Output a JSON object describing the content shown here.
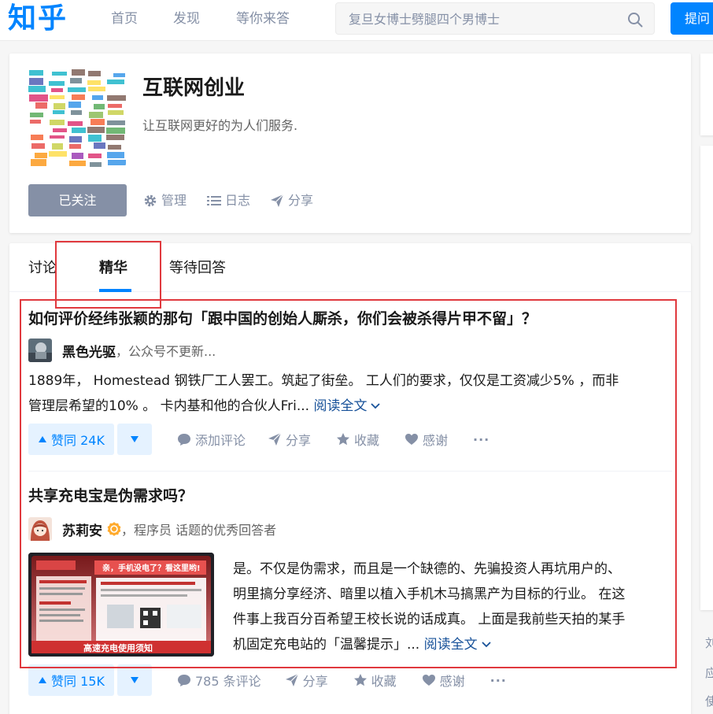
{
  "header": {
    "logo": "知乎",
    "nav": [
      "首页",
      "发现",
      "等你来答"
    ],
    "search_placeholder": "复旦女博士劈腿四个男博士",
    "ask_label": "提问"
  },
  "topic": {
    "title": "互联网创业",
    "description": "让互联网更好的为人们服务.",
    "follow_label": "已关注",
    "tools": [
      "管理",
      "日志",
      "分享"
    ]
  },
  "tabs": {
    "items": [
      "讨论",
      "精华",
      "等待回答"
    ],
    "active": "精华"
  },
  "feed": [
    {
      "question": "如何评价经纬张颖的那句「跟中国的创始人厮杀，你们会被杀得片甲不留」？",
      "author": "黑色光驱",
      "bio": "，公众号不更新...",
      "excerpt_line1": "1889年， Homestead 钢铁厂工人罢工。筑起了街垒。 工人们的要求，仅仅是工资减少5% ，而非",
      "excerpt_line2": "管理层希望的10% 。 卡内基和他的合伙人Fri...",
      "read_more": "阅读全文",
      "vote": "赞同 24K",
      "actions": [
        "添加评论",
        "分享",
        "收藏",
        "感谢"
      ],
      "more": "···"
    },
    {
      "question": "共享充电宝是伪需求吗？",
      "author": "苏莉安",
      "bio": "，程序员 话题的优秀回答者",
      "excerpt_lines": [
        "是。不仅是伪需求，而且是一个缺德的、先骗投资人再坑用户的、",
        "明里搞分享经济、暗里以植入手机木马搞黑产为目标的行业。 在这",
        "件事上我百分百希望王校长说的话成真。 上面是我前些天拍的某手",
        "机固定充电站的「温馨提示」..."
      ],
      "read_more": "阅读全文",
      "thumb_banner": "亲，手机没电了？看这里哟!",
      "thumb_footer": "高速充电使用须知",
      "vote": "赞同 15K",
      "actions": [
        "785 条评论",
        "分享",
        "收藏",
        "感谢"
      ],
      "more": "···"
    }
  ],
  "side": [
    "刘",
    "应",
    "使"
  ],
  "colors": {
    "brand": "#0084ff",
    "annotation": "#e0393e",
    "muted": "#8590a6"
  }
}
